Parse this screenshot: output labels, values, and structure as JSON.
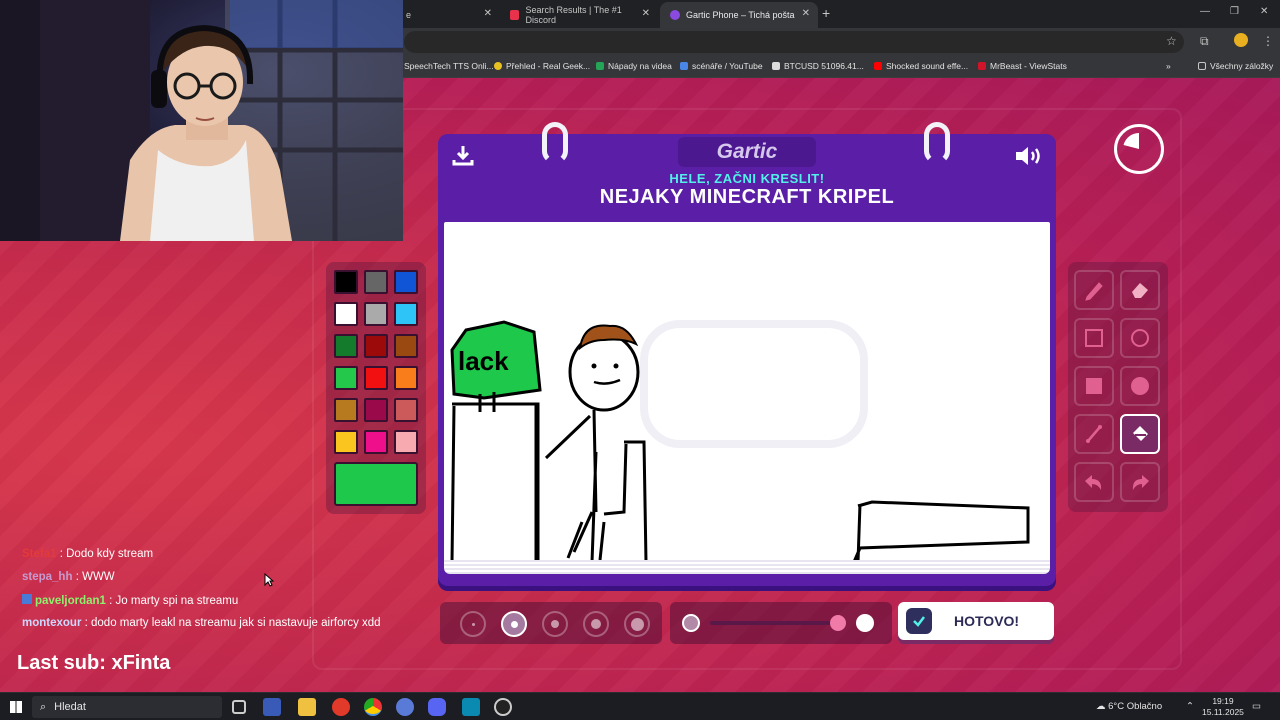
{
  "browser": {
    "tabs": [
      {
        "label": "e",
        "active": false
      },
      {
        "label": "Search Results | The #1 Discord",
        "active": false
      },
      {
        "label": "Gartic Phone – Tichá pošta",
        "active": true
      }
    ],
    "bookmarks": [
      {
        "label": "SpeechTech TTS Onli..."
      },
      {
        "label": "Přehled - Real Geek..."
      },
      {
        "label": "Nápady na videa"
      },
      {
        "label": "scénáře / YouTube"
      },
      {
        "label": "BTCUSD 51096.41..."
      },
      {
        "label": "Shocked sound effe..."
      },
      {
        "label": "MrBeast - ViewStats"
      }
    ],
    "all_bookmarks_label": "Všechny záložky"
  },
  "game": {
    "logo": "Gartic",
    "subtitle": "HELE, ZAČNI KRESLIT!",
    "prompt": "NEJAKY MINECRAFT KRIPEL",
    "done_label": "HOTOVO!",
    "colors": [
      "#000000",
      "#666666",
      "#0f55d6",
      "#ffffff",
      "#aaaaaa",
      "#2ec4f8",
      "#147a2c",
      "#9c0a0a",
      "#9a4a10",
      "#24c84a",
      "#f21010",
      "#f97d1a",
      "#b87a1e",
      "#9a0a4a",
      "#cc5a5a",
      "#f9c51e",
      "#ef0f8b",
      "#f7aab0"
    ],
    "current_color": "#1ec84a",
    "brush_sizes": 5,
    "selected_size_index": 1,
    "selected_tool": "fill-bucket",
    "drawing_text": "lack"
  },
  "chat": [
    {
      "user": "Stefa1",
      "user_color": "#e33a3a",
      "message": ": Dodo kdy stream"
    },
    {
      "user": "stepa_hh",
      "user_color": "#c79bd0",
      "message": ": WWW"
    },
    {
      "user": "paveljordan1",
      "user_color": "#8ef06e",
      "message": ": Jo marty spi na streamu"
    },
    {
      "user": "montexour",
      "user_color": "#cfd8ff",
      "message": ": dodo marty leakl na streamu jak si nastavuje airforcy xdd"
    }
  ],
  "overlay": {
    "last_sub": "Last sub: xFinta"
  },
  "taskbar": {
    "search_placeholder": "Hledat",
    "weather": "6°C  Oblačno",
    "time": "19:19",
    "date": "15.11.2025"
  }
}
